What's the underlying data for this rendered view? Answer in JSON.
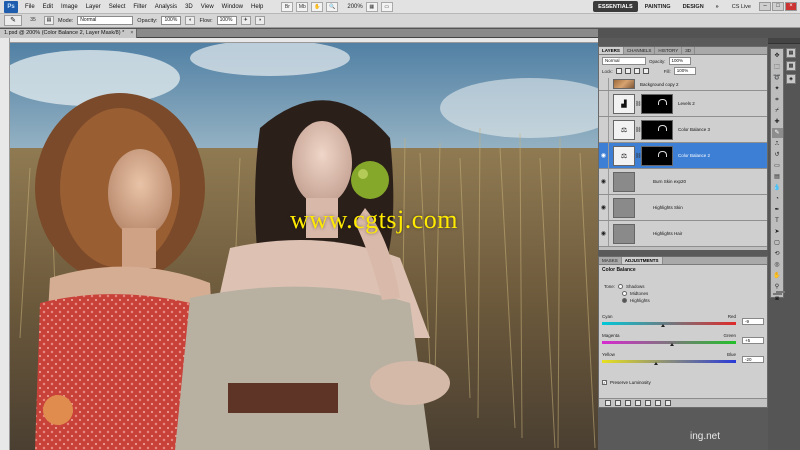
{
  "app": {
    "logo": "Ps",
    "menu": [
      "File",
      "Edit",
      "Image",
      "Layer",
      "Select",
      "Filter",
      "Analysis",
      "3D",
      "View",
      "Window",
      "Help"
    ],
    "zoom": "200%",
    "workspaces": [
      "ESSENTIALS",
      "PAINTING",
      "DESIGN"
    ],
    "workspace_more": "»",
    "cs_live": "CS Live"
  },
  "options": {
    "brush_size": "35",
    "mode_label": "Mode:",
    "mode_value": "Normal",
    "opacity_label": "Opacity:",
    "opacity_value": "100%",
    "flow_label": "Flow:",
    "flow_value": "100%"
  },
  "document": {
    "tab_title": "1.psd @ 200% (Color Balance 2, Layer Mask/8) *"
  },
  "watermark": {
    "main": "www.cgtsj.com",
    "bottom": "ing.net"
  },
  "layers_panel": {
    "tabs": [
      "LAYERS",
      "CHANNELS",
      "HISTORY",
      "3D"
    ],
    "blend_mode": "Normal",
    "opacity_label": "Opacity:",
    "opacity_value": "100%",
    "lock_label": "Lock:",
    "fill_label": "Fill:",
    "fill_value": "100%",
    "layers": [
      {
        "name": "Background copy 2",
        "type": "photo",
        "visible": false,
        "selected": false
      },
      {
        "name": "Levels 2",
        "type": "adjustment",
        "visible": false,
        "selected": false
      },
      {
        "name": "Color Balance 3",
        "type": "adjustment",
        "visible": false,
        "selected": false
      },
      {
        "name": "Color Balance 2",
        "type": "adjustment",
        "visible": true,
        "selected": true
      },
      {
        "name": "Burn Skin exp20",
        "type": "gray",
        "visible": true,
        "selected": false
      },
      {
        "name": "Highlights Skin",
        "type": "gray",
        "visible": true,
        "selected": false
      },
      {
        "name": "Highlights Hair",
        "type": "gray",
        "visible": true,
        "selected": false
      }
    ]
  },
  "adjustments_panel": {
    "tabs": [
      "MASKS",
      "ADJUSTMENTS"
    ],
    "title": "Color Balance",
    "tone_label": "Tone:",
    "tones": [
      "Shadows",
      "Midtones",
      "Highlights"
    ],
    "selected_tone": "Highlights",
    "sliders": [
      {
        "left": "Cyan",
        "right": "Red",
        "value": "-9",
        "fraction": 0.455
      },
      {
        "left": "Magenta",
        "right": "Green",
        "value": "+5",
        "fraction": 0.525
      },
      {
        "left": "Yellow",
        "right": "Blue",
        "value": "-20",
        "fraction": 0.4
      }
    ],
    "preserve_luminosity": "Preserve Luminosity"
  },
  "colors": {
    "selected_layer": "#3c7fd5",
    "watermark": "#ffea00"
  }
}
